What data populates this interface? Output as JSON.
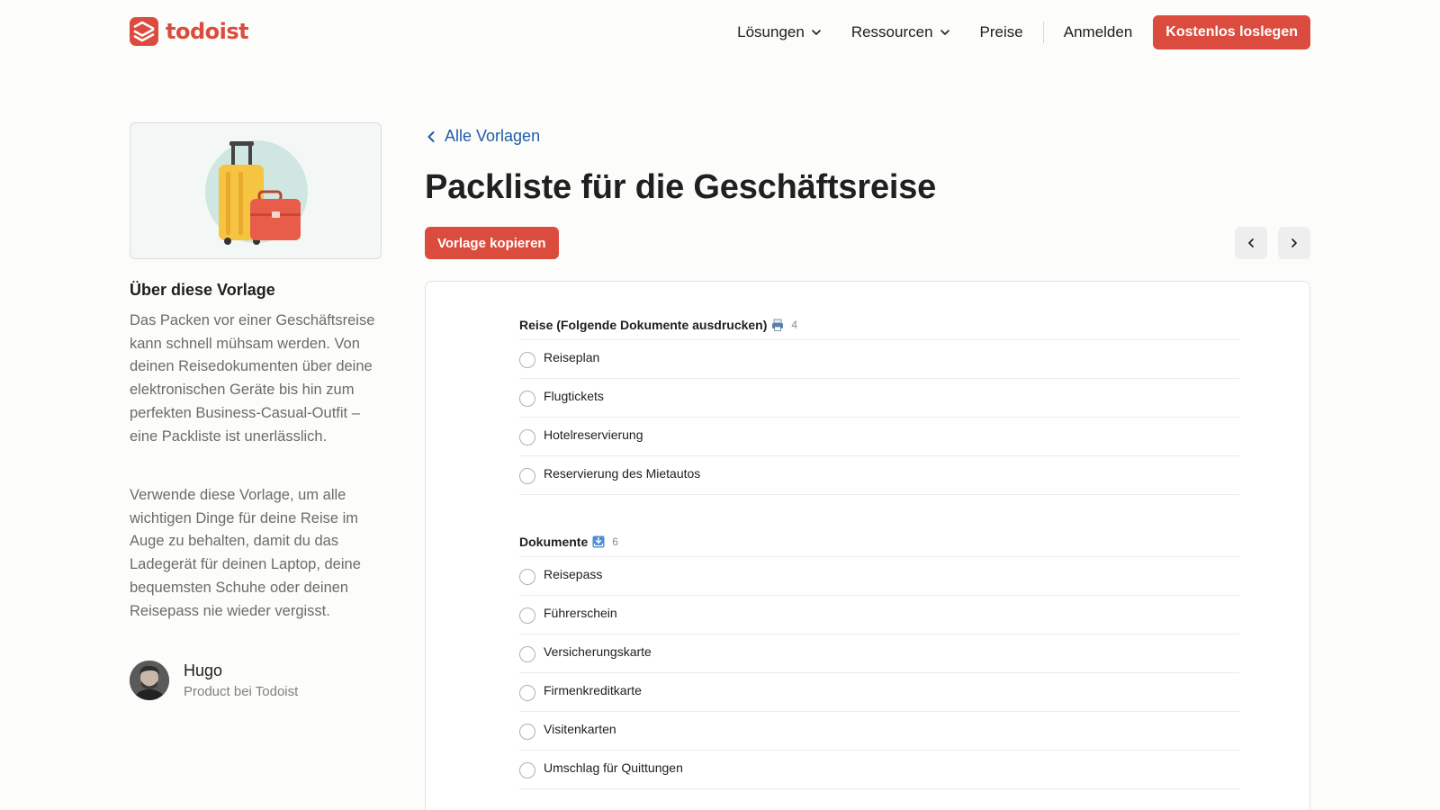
{
  "brand": {
    "name": "todoist",
    "accent": "#dc4c3e"
  },
  "nav": {
    "solutions": "Lösungen",
    "resources": "Ressourcen",
    "pricing": "Preise",
    "login": "Anmelden",
    "cta": "Kostenlos loslegen"
  },
  "sidebar": {
    "about_title": "Über diese Vorlage",
    "about_p1": "Das Packen vor einer Geschäftsreise kann schnell mühsam werden. Von deinen Reisedokumenten über deine elektronischen Geräte bis hin zum perfekten Business-Casual-Outfit – eine Packliste ist unerlässlich.",
    "about_p2": "Verwende diese Vorlage, um alle wichtigen Dinge für deine Reise im Auge zu behalten, damit du das Ladegerät für deinen Laptop, deine bequemsten Schuhe oder deinen Reisepass nie wieder vergisst.",
    "author_name": "Hugo",
    "author_role": "Product bei Todoist"
  },
  "main": {
    "back_label": "Alle Vorlagen",
    "title": "Packliste für die Geschäftsreise",
    "copy_button": "Vorlage kopieren"
  },
  "sections": [
    {
      "title": "Reise (Folgende Dokumente ausdrucken)",
      "emoji_icon": "printer-icon",
      "count": "4",
      "tasks": [
        "Reiseplan",
        "Flugtickets",
        "Hotelreservierung",
        "Reservierung des Mietautos"
      ]
    },
    {
      "title": "Dokumente",
      "emoji_icon": "inbox-tray-icon",
      "count": "6",
      "tasks": [
        "Reisepass",
        "Führerschein",
        "Versicherungskarte",
        "Firmenkreditkarte",
        "Visitenkarten",
        "Umschlag für Quittungen"
      ]
    }
  ]
}
